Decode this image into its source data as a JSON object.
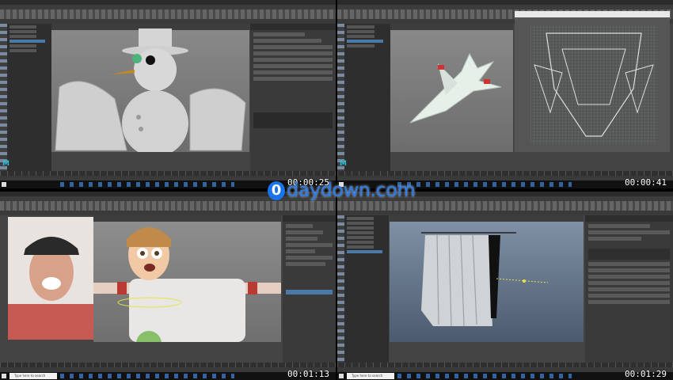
{
  "panels": [
    {
      "id": "snowman",
      "timestamp": "00:00:25",
      "logo": "M"
    },
    {
      "id": "jet",
      "timestamp": "00:00:41",
      "logo": "M"
    },
    {
      "id": "character",
      "timestamp": "00:01:13",
      "search": "Type here to search"
    },
    {
      "id": "curtain",
      "timestamp": "00:01:29",
      "search": "Type here to search"
    }
  ],
  "watermark": {
    "badge": "0",
    "text": "daydown.com"
  },
  "colors": {
    "maya_bg": "#444444",
    "viewport": "#7a7a7a",
    "accent": "#29c1d8",
    "watermark": "#2f7be6"
  }
}
